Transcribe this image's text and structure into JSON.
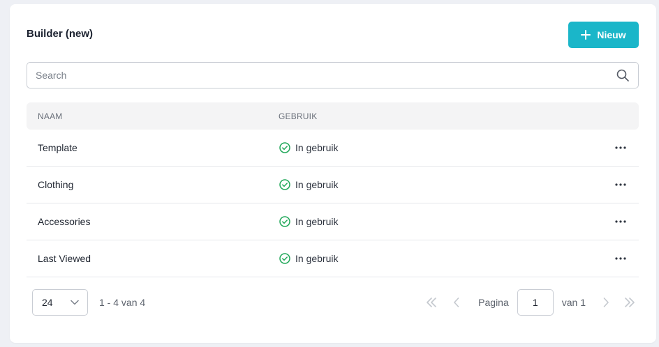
{
  "header": {
    "title": "Builder (new)",
    "new_button_label": "Nieuw"
  },
  "search": {
    "placeholder": "Search",
    "value": ""
  },
  "table": {
    "columns": [
      "NAAM",
      "GEBRUIK"
    ],
    "rows": [
      {
        "name": "Template",
        "usage": "In gebruik"
      },
      {
        "name": "Clothing",
        "usage": "In gebruik"
      },
      {
        "name": "Accessories",
        "usage": "In gebruik"
      },
      {
        "name": "Last Viewed",
        "usage": "In gebruik"
      }
    ]
  },
  "pagination": {
    "per_page": "24",
    "range_text": "1 - 4 van 4",
    "page_label": "Pagina",
    "current_page": "1",
    "total_text": "van 1"
  },
  "icons": {
    "add": "plus-icon",
    "search": "search-icon",
    "status": "check-circle-icon",
    "row_menu": "more-horizontal-icon",
    "per_page_toggle": "chevron-down-icon",
    "first": "chevrons-left-icon",
    "prev": "chevron-left-icon",
    "next": "chevron-right-icon",
    "last": "chevrons-right-icon"
  },
  "colors": {
    "accent": "#1ab6c9",
    "success": "#22a85a",
    "background": "#eef0f5"
  }
}
